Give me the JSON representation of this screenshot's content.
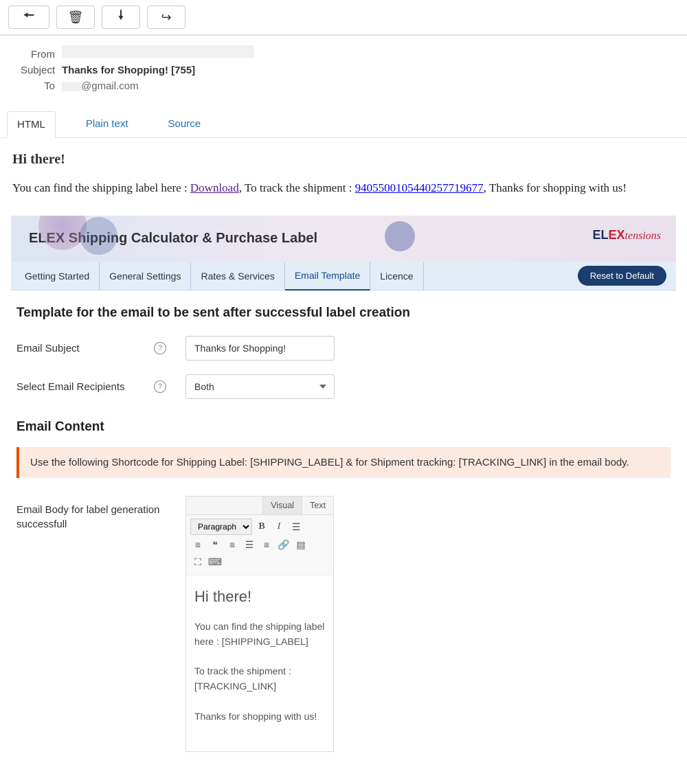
{
  "toolbar": {
    "back": "←",
    "trash": "🗑",
    "download": "⬇",
    "forward": "↪"
  },
  "email": {
    "header": {
      "from_label": "From",
      "subject_label": "Subject",
      "subject_value": "Thanks for Shopping! [755]",
      "to_label": "To",
      "to_value": "@gmail.com"
    },
    "tabs": {
      "html": "HTML",
      "plain": "Plain text",
      "source": "Source"
    },
    "body": {
      "greeting": "Hi there!",
      "text_pre": "You can find the shipping label here : ",
      "download": "Download",
      "text_mid": ", To track the shipment : ",
      "tracking": "9405500105440257719677",
      "text_post": ", Thanks for shopping with us!"
    }
  },
  "plugin": {
    "title": "ELEX Shipping Calculator & Purchase Label",
    "logo": {
      "el": "EL",
      "ex": "EX",
      "script": "tensions"
    },
    "nav": {
      "getting_started": "Getting Started",
      "general_settings": "General Settings",
      "rates_services": "Rates & Services",
      "email_template": "Email Template",
      "licence": "Licence",
      "reset": "Reset to Default"
    },
    "section": {
      "title": "Template for the email to be sent after successful label creation",
      "subject_label": "Email Subject",
      "subject_value": "Thanks for Shopping!",
      "recipients_label": "Select Email Recipients",
      "recipients_value": "Both",
      "content_title": "Email Content",
      "notice": "Use the following Shortcode for Shipping Label: [SHIPPING_LABEL] & for Shipment tracking: [TRACKING_LINK] in the email body.",
      "body_label": "Email Body for label generation successfull"
    },
    "editor": {
      "tabs": {
        "visual": "Visual",
        "text": "Text"
      },
      "paragraph": "Paragraph",
      "content": {
        "greeting": "Hi there!",
        "p1": "You can find the shipping label here : [SHIPPING_LABEL]",
        "p2": "To track the shipment : [TRACKING_LINK]",
        "p3": "Thanks for shopping with us!"
      }
    }
  }
}
